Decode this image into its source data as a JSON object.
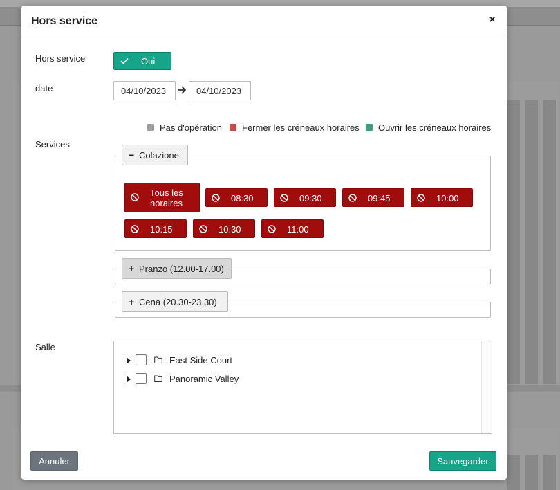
{
  "modal": {
    "title": "Hors service",
    "close_label": "×"
  },
  "form": {
    "out_of_service_label": "Hors service",
    "toggle_label": "Oui",
    "date_label": "date",
    "date_from": "04/10/2023",
    "date_to": "04/10/2023",
    "services_label": "Services",
    "room_label": "Salle"
  },
  "legend": [
    {
      "label": "Pas d'opération",
      "color": "#9e9e9e"
    },
    {
      "label": "Fermer les créneaux horaires",
      "color": "#c94a4a"
    },
    {
      "label": "Ouvrir les créneaux horaires",
      "color": "#3aa37a"
    }
  ],
  "services": [
    {
      "name": "Colazione",
      "expanded": true,
      "slots": [
        "Tous les horaires",
        "08:30",
        "09:30",
        "09:45",
        "10:00",
        "10:15",
        "10:30",
        "11:00"
      ]
    },
    {
      "name": "Pranzo (12.00-17.00)",
      "expanded": false
    },
    {
      "name": "Cena (20.30-23.30)",
      "expanded": false
    }
  ],
  "rooms": [
    {
      "name": "East Side Court"
    },
    {
      "name": "Panoramic Valley"
    }
  ],
  "footer": {
    "cancel_label": "Annuler",
    "save_label": "Sauvegarder"
  },
  "colors": {
    "accent": "#17a589",
    "closed": "#a10d0d",
    "cancel": "#6c757d"
  }
}
